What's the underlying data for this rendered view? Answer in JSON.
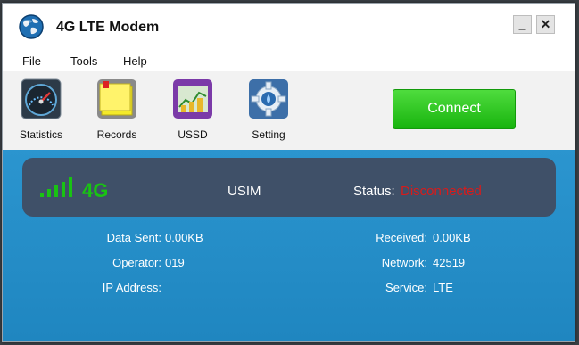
{
  "app": {
    "title": "4G LTE Modem"
  },
  "window_controls": {
    "minimize": "_",
    "close": "✕"
  },
  "menu": [
    "File",
    "Tools",
    "Help"
  ],
  "toolbar": {
    "items": [
      {
        "label": "Statistics",
        "icon": "speedometer-icon"
      },
      {
        "label": "Records",
        "icon": "sticky-note-icon"
      },
      {
        "label": "USSD",
        "icon": "ussd-chart-icon"
      },
      {
        "label": "Setting",
        "icon": "gear-icon"
      }
    ],
    "connect_label": "Connect"
  },
  "status": {
    "network_type": "4G",
    "sim": "USIM",
    "status_label": "Status:",
    "status_value": "Disconnected",
    "signal_bars": 5
  },
  "info": {
    "data_sent": {
      "label": "Data Sent:",
      "value": "0.00KB"
    },
    "received": {
      "label": "Received:",
      "value": "0.00KB"
    },
    "operator": {
      "label": "Operator:",
      "value": "019"
    },
    "network": {
      "label": "Network:",
      "value": "42519"
    },
    "ip_address": {
      "label": "IP Address:",
      "value": ""
    },
    "service": {
      "label": "Service:",
      "value": "LTE"
    }
  },
  "colors": {
    "main_bg": "#2290c8",
    "panel_bg": "#3f5068",
    "signal_green": "#19c313",
    "status_red": "#d81b1b",
    "connect_green": "#22c018"
  }
}
